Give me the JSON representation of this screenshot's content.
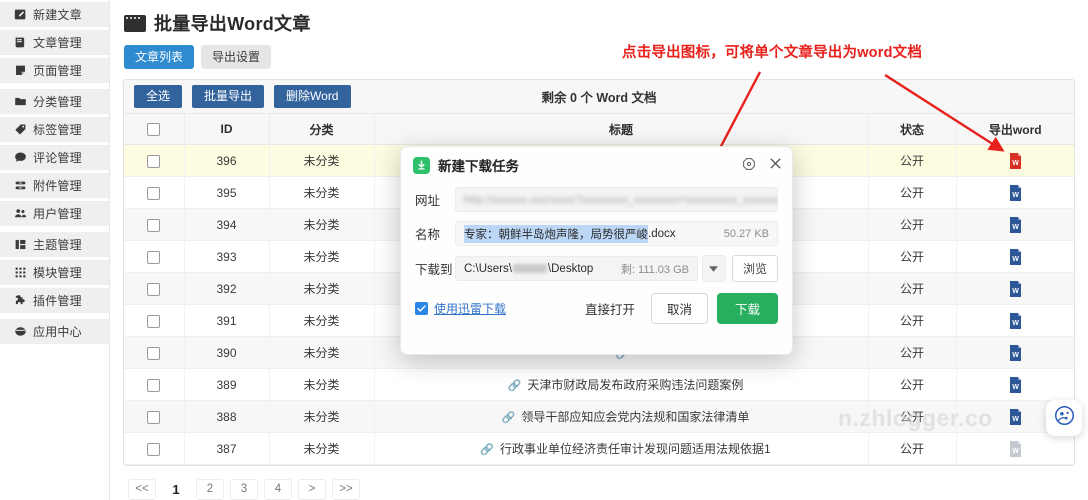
{
  "sidebar": {
    "items": [
      {
        "label": "新建文章",
        "icon": "edit-square-icon"
      },
      {
        "label": "文章管理",
        "icon": "article-icon"
      },
      {
        "label": "页面管理",
        "icon": "page-icon"
      },
      {
        "label": "分类管理",
        "icon": "folder-icon"
      },
      {
        "label": "标签管理",
        "icon": "tag-icon"
      },
      {
        "label": "评论管理",
        "icon": "comment-icon"
      },
      {
        "label": "附件管理",
        "icon": "attachment-icon"
      },
      {
        "label": "用户管理",
        "icon": "users-icon"
      },
      {
        "label": "主题管理",
        "icon": "theme-icon"
      },
      {
        "label": "模块管理",
        "icon": "grid-icon"
      },
      {
        "label": "插件管理",
        "icon": "plugin-icon"
      },
      {
        "label": "应用中心",
        "icon": "app-center-icon"
      }
    ]
  },
  "header": {
    "title": "批量导出Word文章",
    "window_icon": "window-icon"
  },
  "tabs": [
    {
      "label": "文章列表",
      "active": true
    },
    {
      "label": "导出设置",
      "active": false
    }
  ],
  "toolbar": {
    "select_all_label": "全选",
    "batch_export_label": "批量导出",
    "delete_word_label": "删除Word",
    "remaining_text": "剩余 0 个 Word 文档"
  },
  "table": {
    "columns": [
      "",
      "ID",
      "分类",
      "标题",
      "状态",
      "导出word"
    ],
    "header_checkbox": "select-all-checkbox",
    "rows": [
      {
        "id": "396",
        "category": "未分类",
        "title": "",
        "status": "公开",
        "export_icon": "word-doc-icon-red",
        "highlight": true
      },
      {
        "id": "395",
        "category": "未分类",
        "title": "",
        "status": "公开",
        "export_icon": "word-doc-icon",
        "highlight": false
      },
      {
        "id": "394",
        "category": "未分类",
        "title": "",
        "status": "公开",
        "export_icon": "word-doc-icon",
        "highlight": false
      },
      {
        "id": "393",
        "category": "未分类",
        "title": "",
        "status": "公开",
        "export_icon": "word-doc-icon",
        "highlight": false
      },
      {
        "id": "392",
        "category": "未分类",
        "title": "",
        "status": "公开",
        "export_icon": "word-doc-icon",
        "highlight": false
      },
      {
        "id": "391",
        "category": "未分类",
        "title": "",
        "status": "公开",
        "export_icon": "word-doc-icon",
        "highlight": false
      },
      {
        "id": "390",
        "category": "未分类",
        "title": "",
        "status": "公开",
        "export_icon": "word-doc-icon",
        "highlight": false
      },
      {
        "id": "389",
        "category": "未分类",
        "title": "天津市财政局发布政府采购违法问题案例",
        "status": "公开",
        "export_icon": "word-doc-icon",
        "highlight": false
      },
      {
        "id": "388",
        "category": "未分类",
        "title": "领导干部应知应会党内法规和国家法律清单",
        "status": "公开",
        "export_icon": "word-doc-icon",
        "highlight": false
      },
      {
        "id": "387",
        "category": "未分类",
        "title": "行政事业单位经济责任审计发现问题适用法规依据1",
        "status": "公开",
        "export_icon": "word-doc-icon-grey",
        "highlight": false
      }
    ]
  },
  "pagination": {
    "items": [
      "<<",
      "1",
      "2",
      "3",
      "4",
      ">",
      ">>"
    ],
    "current": "1"
  },
  "annotation": {
    "text": "点击导出图标，可将单个文章导出为word文档",
    "color": "#e8211c"
  },
  "modal": {
    "title": "新建下载任务",
    "icon": "download-badge-icon",
    "settings_icon": "gear-icon",
    "close_icon": "close-icon",
    "fields": {
      "url_label": "网址",
      "url_value": "http://xxxxxx.xxx/xxxx/?xxxxxxxx_xxxxxxxx=xxxxxxxxx_xxxxxxxx",
      "name_label": "名称",
      "name_value_selected": "专家：朝鲜半岛炮声隆，局势很严峻",
      "name_extension": ".docx",
      "file_size": "50.27 KB",
      "path_label": "下载到",
      "path_prefix": "C:\\Users\\",
      "path_suffix": "\\Desktop",
      "free_space": "剩: 111.03 GB",
      "browse_label": "浏览"
    },
    "actions": {
      "xunlei_label": "使用迅雷下载",
      "open_direct_label": "直接打开",
      "cancel_label": "取消",
      "download_label": "下载"
    }
  },
  "watermark": {
    "text": "n.zhlogger.co"
  },
  "float_button": {
    "icon": "assistant-icon"
  }
}
